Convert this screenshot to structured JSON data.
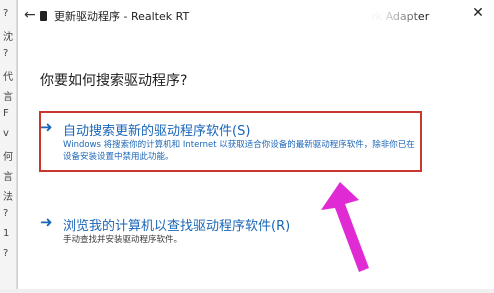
{
  "side_strip": [
    "?",
    "沈",
    "?",
    "代",
    "言",
    "F",
    "v",
    "何",
    "言",
    "法",
    "?",
    "1",
    "?"
  ],
  "dialog": {
    "title": "更新驱动程序 - Realtek RT",
    "title_tail": "rk Adapter",
    "question": "你要如何搜索驱动程序?",
    "options": [
      {
        "title": "自动搜索更新的驱动程序软件(S)",
        "description": "Windows 将搜索你的计算机和 Internet 以获取适合你设备的最新驱动程序软件，除非你已在设备安装设置中禁用此功能。"
      },
      {
        "title": "浏览我的计算机以查找驱动程序软件(R)",
        "description": "手动查找并安装驱动程序软件。"
      }
    ]
  },
  "icons": {
    "back": "back-arrow-icon",
    "close": "close-icon",
    "device": "device-icon",
    "option_arrow": "right-arrow-icon"
  },
  "colors": {
    "link": "#1a66b8",
    "highlight": "#c8362e",
    "pointer": "#e02bd4"
  }
}
